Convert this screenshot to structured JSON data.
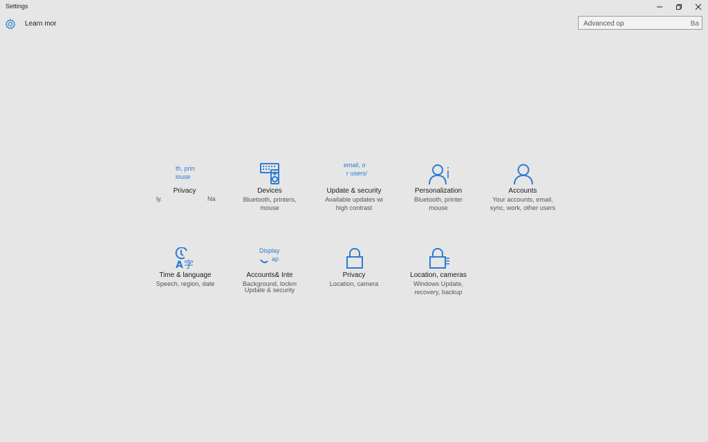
{
  "window": {
    "title": "Settings"
  },
  "header": {
    "learn_more": "Learn mor"
  },
  "search": {
    "placeholder": "Advanced op",
    "tail": "Ba"
  },
  "tiles": [
    {
      "name": "Privacy",
      "ghost_top": "th, prin",
      "ghost_mid": "iouse",
      "ghost_left": "ly.",
      "ghost_right": "Na"
    },
    {
      "name": "Devices",
      "line1": "Bluetooth, printers,",
      "line2": "mouse"
    },
    {
      "name": "Update & security",
      "ghost_top": "email, o",
      "ghost_mid": "r users/",
      "line1": "Available updates wi",
      "line2": "high contrast"
    },
    {
      "name": "Personalization",
      "line1": "Bluetooth, printer",
      "line2": "mouse"
    },
    {
      "name": "Accounts",
      "line1": "Your accounts, email,",
      "line2": "sync, work, other users"
    },
    {
      "name": "Time & language",
      "line1": "Speech, region, date"
    },
    {
      "name": "Accounts& Inte",
      "ghost_top": "Display",
      "ghost_mid": "ap",
      "line1": "Background, lockm",
      "line2": "Update & security"
    },
    {
      "name": "Privacy",
      "line1": "Location, camera"
    },
    {
      "name": "Location, cameras",
      "line1": "Windows Update,",
      "line2": "recovery, backup"
    }
  ],
  "icons": {
    "gear": "gear-icon",
    "devices": "keyboard-speaker-icon",
    "personalization": "person-icon",
    "accounts": "person-icon",
    "time": "time-language-icon",
    "privacy": "lock-icon",
    "location": "lock-icon"
  },
  "colors": {
    "accent": "#2a7bd4",
    "background": "#e6e6e6"
  }
}
